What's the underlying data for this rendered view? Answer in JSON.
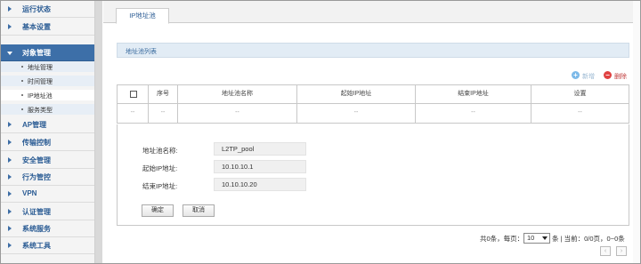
{
  "sidebar": {
    "items": [
      {
        "label": "运行状态"
      },
      {
        "label": "基本设置"
      },
      {
        "label": "对象管理"
      },
      {
        "label": "AP管理"
      },
      {
        "label": "传输控制"
      },
      {
        "label": "安全管理"
      },
      {
        "label": "行为管控"
      },
      {
        "label": "VPN"
      },
      {
        "label": "认证管理"
      },
      {
        "label": "系统服务"
      },
      {
        "label": "系统工具"
      }
    ],
    "subitems": [
      {
        "label": "地址管理"
      },
      {
        "label": "时间管理"
      },
      {
        "label": "IP地址池"
      },
      {
        "label": "服务类型"
      }
    ]
  },
  "tabs": [
    {
      "label": "IP地址池"
    }
  ],
  "section": {
    "title": "地址池列表"
  },
  "toolbar": {
    "add_label": "新增",
    "delete_label": "删除"
  },
  "table": {
    "columns": [
      "序号",
      "地址池名称",
      "起始IP地址",
      "结束IP地址",
      "设置"
    ],
    "row": [
      "--",
      "--",
      "--",
      "--",
      "--",
      "--"
    ]
  },
  "form": {
    "name_label": "地址池名称:",
    "name_value": "L2TP_pool",
    "start_label": "起始IP地址:",
    "start_value": "10.10.10.1",
    "end_label": "结束IP地址:",
    "end_value": "10.10.10.20",
    "ok_label": "确定",
    "cancel_label": "取消"
  },
  "pagination": {
    "total_text": "共0条，每页：",
    "per_page": "10",
    "status_text": "条 | 当前：0/0页，0~0条",
    "prev_label": "‹",
    "next_label": "›"
  },
  "colors": {
    "accent": "#3d6fa8",
    "delete": "#e04141",
    "add": "#7cb9e8"
  },
  "icons": {
    "add": "plus-circle-icon",
    "delete": "minus-circle-icon"
  }
}
